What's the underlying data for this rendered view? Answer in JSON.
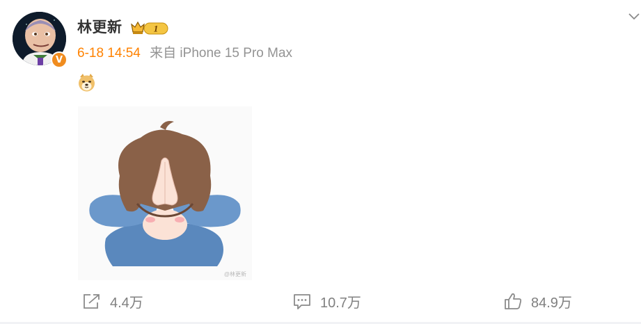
{
  "post": {
    "username": "林更新",
    "vip_level": "1",
    "verified_mark": "V",
    "time": "6-18 14:54",
    "source": "来自 iPhone 15 Pro Max",
    "emoji_icon": "doge-emoji",
    "image_watermark": "@林更新"
  },
  "actions": {
    "share_count": "4.4万",
    "comment_count": "10.7万",
    "like_count": "84.9万"
  },
  "colors": {
    "time_orange": "#ff8200",
    "source_gray": "#939393",
    "action_gray": "#808080",
    "verified_orange": "#f08c1f"
  }
}
